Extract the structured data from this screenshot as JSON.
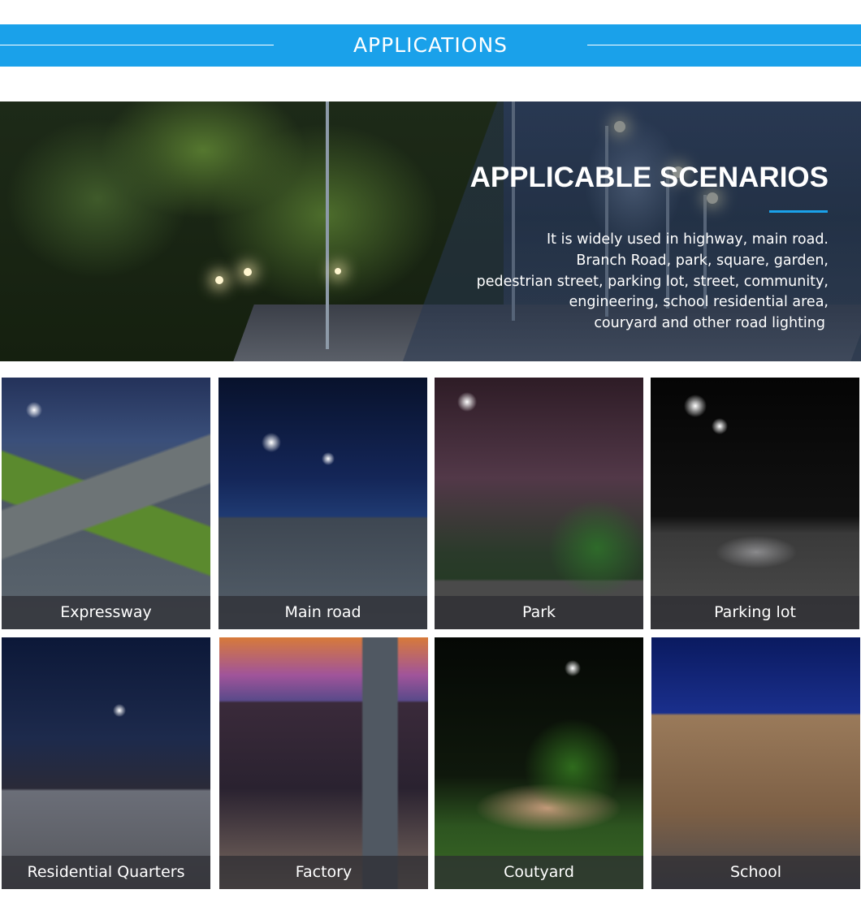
{
  "header": {
    "title": "APPLICATIONS"
  },
  "hero": {
    "heading": "APPLICABLE SCENARIOS",
    "description_lines": [
      "It is widely used in highway, main road.",
      "Branch Road, park, square, garden,",
      "pedestrian street, parking lot, street, community,",
      "engineering, school residential area,",
      "couryard and other road lighting"
    ]
  },
  "gallery": {
    "items": [
      {
        "label": "Expressway"
      },
      {
        "label": "Main road"
      },
      {
        "label": "Park"
      },
      {
        "label": "Parking lot"
      },
      {
        "label": "Residential Quarters"
      },
      {
        "label": "Factory"
      },
      {
        "label": "Coutyard"
      },
      {
        "label": "School"
      }
    ]
  },
  "colors": {
    "accent": "#1aa1ea",
    "caption_bg": "#2d2d32"
  }
}
